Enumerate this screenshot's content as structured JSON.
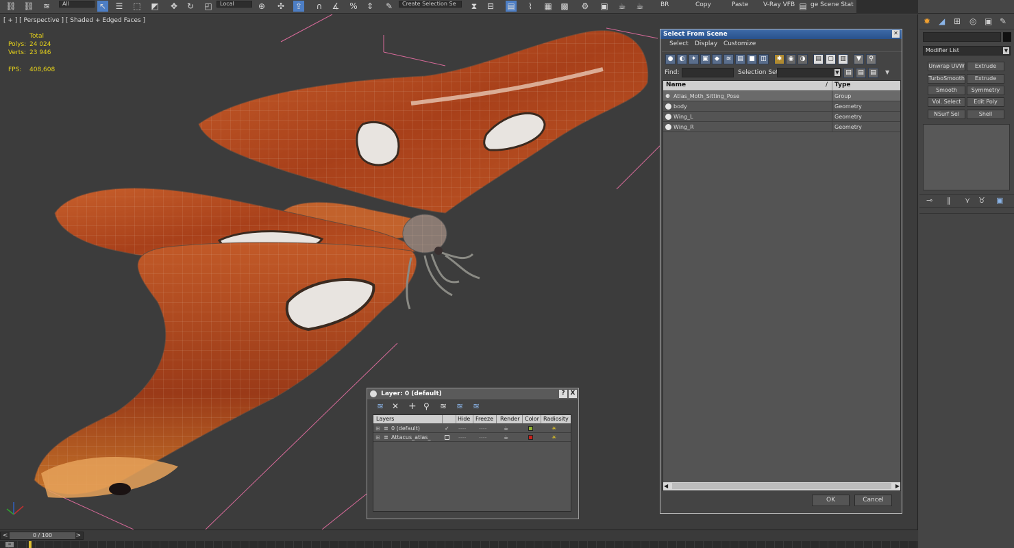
{
  "toolbar": {
    "filter_dropdown": "All",
    "coord_dropdown": "Local",
    "selection_set": "Create Selection Se",
    "labels": [
      "BR",
      "Copy",
      "Paste",
      "V-Ray VFB",
      "ge Scene Stat"
    ]
  },
  "viewport": {
    "label": "[ + ] [ Perspective ] [ Shaded + Edged Faces ]",
    "stats": {
      "total_label": "Total",
      "polys_label": "Polys:",
      "polys_value": "24 024",
      "verts_label": "Verts:",
      "verts_value": "23 946",
      "fps_label": "FPS:",
      "fps_value": "408,608"
    }
  },
  "select_from_scene": {
    "title": "Select From Scene",
    "menus": [
      "Select",
      "Display",
      "Customize"
    ],
    "find_label": "Find:",
    "find_value": "",
    "selection_set_label": "Selection Set:",
    "columns": {
      "name": "Name",
      "sort_marker": "/",
      "type": "Type"
    },
    "rows": [
      {
        "name": "Atlas_Moth_Sitting_Pose",
        "type": "Group"
      },
      {
        "name": "body",
        "type": "Geometry"
      },
      {
        "name": "Wing_L",
        "type": "Geometry"
      },
      {
        "name": "Wing_R",
        "type": "Geometry"
      }
    ],
    "ok": "OK",
    "cancel": "Cancel"
  },
  "layer_dialog": {
    "title": "Layer: 0 (default)",
    "help": "?",
    "close": "X",
    "columns": [
      "Layers",
      "Hide",
      "Freeze",
      "Render",
      "Color",
      "Radiosity"
    ],
    "rows": [
      {
        "name": "0 (default)",
        "color": "#8fb030",
        "current": true
      },
      {
        "name": "Attacus_atlas_",
        "color": "#c8201a",
        "current": false
      }
    ],
    "hide_value": "----",
    "freeze_value": "----"
  },
  "command_panel": {
    "modifier_list": "Modifier List",
    "buttons": [
      [
        "Unwrap UVW",
        "Extrude"
      ],
      [
        "TurboSmooth",
        "Extrude"
      ],
      [
        "Smooth",
        "Symmetry"
      ],
      [
        "Vol. Select",
        "Edit Poly"
      ],
      [
        "NSurf Sel",
        "Shell"
      ]
    ]
  },
  "timeline": {
    "frame_counter": "0 / 100",
    "prev": "<",
    "next": ">"
  },
  "colors": {
    "title_bar_blue": "#2f5d9a",
    "wing_orange": "#b8481e",
    "stat_yellow": "#e6d21a"
  }
}
